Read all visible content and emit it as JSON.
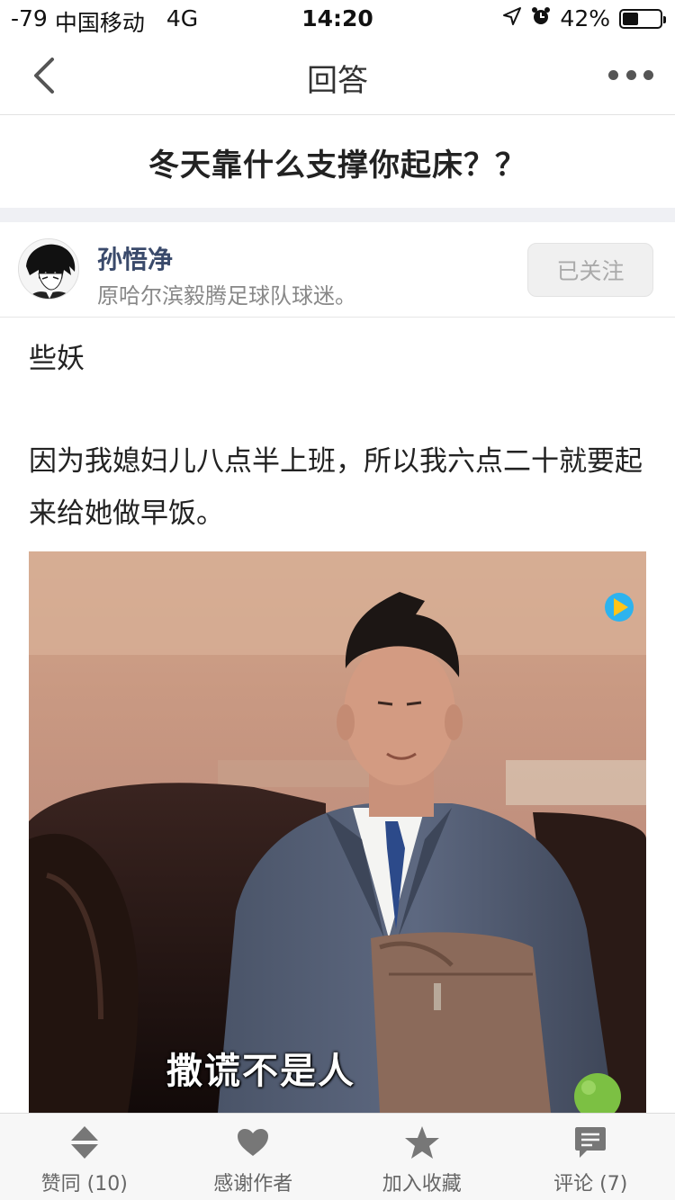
{
  "status_bar": {
    "signal": "-79",
    "carrier": "中国移动",
    "network": "4G",
    "time": "14:20",
    "battery": "42%",
    "battery_level": 0.42
  },
  "nav": {
    "title": "回答"
  },
  "question": {
    "title": "冬天靠什么支撑你起床？？"
  },
  "author": {
    "name": "孙悟净",
    "bio": "原哈尔滨毅腾足球队球迷。",
    "follow_label": "已关注"
  },
  "answer": {
    "paragraphs": [
      "些妖",
      "因为我媳妇儿八点半上班，所以我六点二十就要起来给她做早饭。"
    ],
    "image_caption": "撒谎不是人"
  },
  "toolbar": {
    "upvote": "赞同 (10)",
    "thanks": "感谢作者",
    "collect": "加入收藏",
    "comment": "评论 (7)"
  },
  "colors": {
    "accent_text": "#3a4a6b",
    "toolbar_icon": "#777777"
  }
}
